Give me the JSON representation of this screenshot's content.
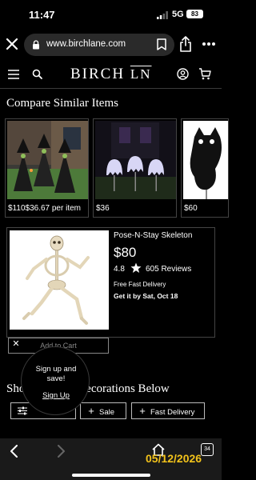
{
  "status": {
    "time": "11:47",
    "network": "5G",
    "battery": "83"
  },
  "browser": {
    "url": "www.birchlane.com"
  },
  "site": {
    "logo_main": "BIRCH ",
    "logo_suffix": "LN"
  },
  "compare": {
    "title": "Compare Similar Items",
    "items": [
      {
        "price": "$110$36.67 per item"
      },
      {
        "price": "$36"
      },
      {
        "price": "$60"
      }
    ]
  },
  "product": {
    "name": "Pose-N-Stay Skeleton",
    "price": "$80",
    "rating": "4.8",
    "reviews": "605 Reviews",
    "delivery": "Free Fast Delivery",
    "get_by": "Get it by Sat, Oct 18",
    "add_to_cart": "Add to Cart"
  },
  "popup": {
    "close": "✕",
    "message_line1": "Sign up and",
    "message_line2": "save!",
    "link": "Sign Up"
  },
  "shop": {
    "title": "Shop Outdoor Decorations Below",
    "filters": [
      {
        "label": "Sale"
      },
      {
        "label": "Fast Delivery"
      }
    ]
  },
  "bottom": {
    "tab_count": "34",
    "datestamp": "05/12/2026"
  }
}
